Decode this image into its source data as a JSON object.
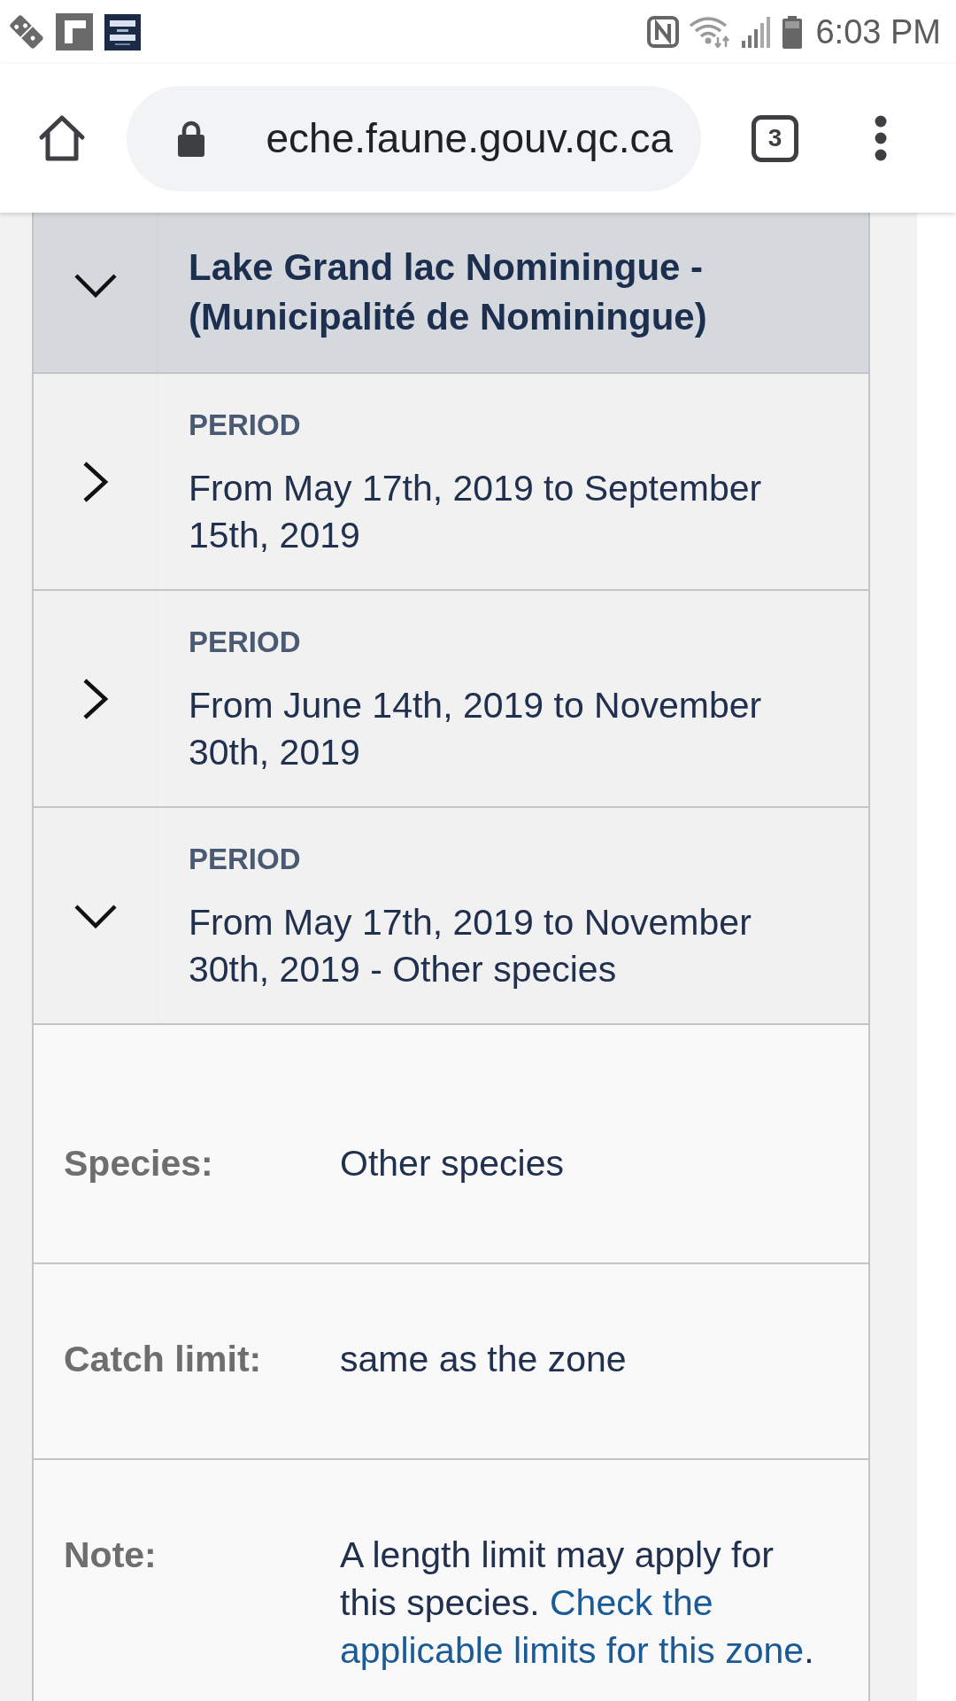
{
  "status_bar": {
    "time": "6:03 PM"
  },
  "browser": {
    "url": "eche.faune.gouv.qc.ca",
    "tab_count": "3"
  },
  "lake": {
    "title": "Lake Grand lac Nominingue - (Municipalité de Nominingue)",
    "expanded": true,
    "periods": [
      {
        "label": "PERIOD",
        "dates": "From May 17th, 2019 to September 15th, 2019",
        "expanded": false
      },
      {
        "label": "PERIOD",
        "dates": "From June 14th, 2019 to November 30th, 2019",
        "expanded": false
      },
      {
        "label": "PERIOD",
        "dates": "From May 17th, 2019 to November 30th, 2019 - Other species",
        "expanded": true,
        "details": [
          {
            "label": "Species:",
            "value": "Other species"
          },
          {
            "label": "Catch limit:",
            "value": "same as the zone"
          },
          {
            "label": "Note:",
            "value": "A length limit may apply for this species.",
            "link": "Check the applicable limits for this zone",
            "value_end": "."
          }
        ]
      }
    ]
  }
}
